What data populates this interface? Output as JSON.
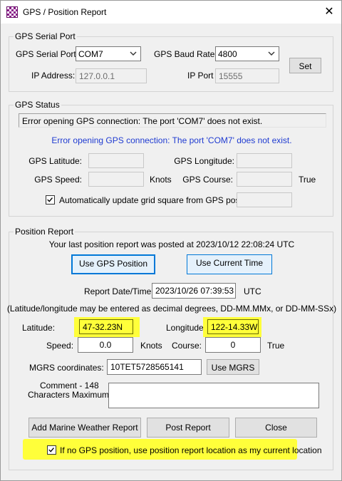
{
  "window": {
    "title": "GPS / Position Report",
    "close_glyph": "✕"
  },
  "serial_port": {
    "group_label": "GPS Serial Port",
    "port_label": "GPS Serial Port:",
    "port_value": "COM7",
    "baud_label": "GPS Baud Rate:",
    "baud_value": "4800",
    "ip_label": "IP Address:",
    "ip_value": "127.0.0.1",
    "ipport_label": "IP Port",
    "ipport_value": "15555",
    "set_label": "Set"
  },
  "gps_status": {
    "group_label": "GPS Status",
    "status_line": "Error opening GPS connection: The port 'COM7' does not exist.",
    "message": "Error opening GPS connection: The port 'COM7' does not exist.",
    "message_color": "#1f3bd1",
    "latitude_label": "GPS Latitude:",
    "latitude_value": "",
    "longitude_label": "GPS Longitude:",
    "longitude_value": "",
    "speed_label": "GPS Speed:",
    "speed_value": "",
    "speed_unit": "Knots",
    "course_label": "GPS Course:",
    "course_value": "",
    "course_unit": "True",
    "auto_update_checked": true,
    "auto_update_label": "Automatically update grid square from GPS position:",
    "grid_value": ""
  },
  "position_report": {
    "group_label": "Position Report",
    "last_posted": "Your last position report was posted at 2023/10/12 22:08:24 UTC",
    "use_gps_label": "Use GPS Position",
    "use_time_label": "Use Current Time",
    "report_dt_label": "Report Date/Time:",
    "report_dt_value": "2023/10/26 07:39:53",
    "utc_label": "UTC",
    "format_hint": "(Latitude/longitude may be entered as decimal degrees, DD-MM.MMx, or DD-MM-SSx)",
    "latitude_label": "Latitude:",
    "latitude_value": "47-32.23N",
    "longitude_label": "Longitude:",
    "longitude_value": "122-14.33W",
    "speed_label": "Speed:",
    "speed_value": "0.0",
    "speed_unit": "Knots",
    "course_label": "Course:",
    "course_value": "0",
    "course_unit": "True",
    "mgrs_label": "MGRS coordinates:",
    "mgrs_value": "10TET5728565141",
    "use_mgrs_label": "Use MGRS",
    "comment_label_1": "Comment - 148",
    "comment_label_2": "Characters Maximum:",
    "comment_value": "",
    "add_weather_label": "Add Marine Weather Report",
    "post_label": "Post Report",
    "close_label": "Close",
    "fallback_checked": true,
    "fallback_label": "If no GPS position, use position report location as my current location"
  },
  "colors": {
    "highlight": "#ffff3a",
    "accent_border": "#0078d7"
  },
  "icons": {
    "app": "checkered-app-icon",
    "close": "close-icon",
    "dropdown": "chevron-down-icon",
    "check": "check-icon"
  }
}
